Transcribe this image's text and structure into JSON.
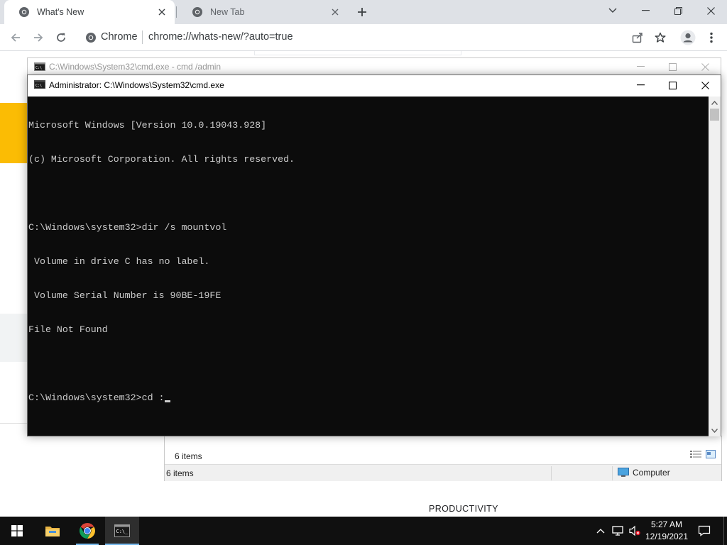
{
  "browser": {
    "tabs": [
      {
        "title": "What's New",
        "active": true
      },
      {
        "title": "New Tab",
        "active": false
      }
    ],
    "omnibox": {
      "site_chip": "Chrome",
      "url": "chrome://whats-new/?auto=true"
    },
    "page": {
      "section_heading": "PRODUCTIVITY"
    }
  },
  "explorer": {
    "items_count_pane": "6 items",
    "status_items": "6 items",
    "status_location": "Computer"
  },
  "cmd_back": {
    "title": "C:\\Windows\\System32\\cmd.exe - cmd  /admin"
  },
  "cmd": {
    "title": "Administrator: C:\\Windows\\System32\\cmd.exe",
    "lines": [
      "Microsoft Windows [Version 10.0.19043.928]",
      "(c) Microsoft Corporation. All rights reserved.",
      "",
      "C:\\Windows\\system32>dir /s mountvol",
      " Volume in drive C has no label.",
      " Volume Serial Number is 90BE-19FE",
      "File Not Found",
      ""
    ],
    "prompt": "C:\\Windows\\system32>cd :"
  },
  "taskbar": {
    "apps": [
      "File Explorer",
      "Google Chrome",
      "Command Prompt"
    ],
    "clock_time": "5:27 AM",
    "clock_date": "12/19/2021"
  },
  "colors": {
    "console_bg": "#0c0c0c",
    "console_fg": "#cccccc",
    "tabstrip": "#dee1e6",
    "taskbar": "#101010",
    "accent": "#76b9ed"
  }
}
